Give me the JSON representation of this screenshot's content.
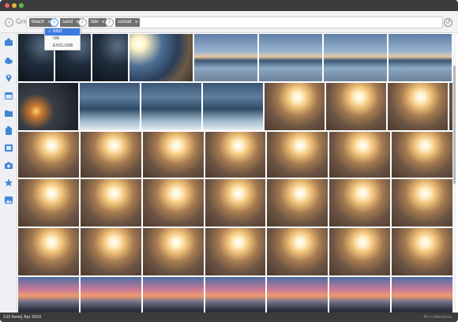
{
  "window": {
    "view_title": "Grid"
  },
  "search": {
    "chips": [
      {
        "label": "beach"
      },
      {
        "label": "sand"
      },
      {
        "label": "tide"
      },
      {
        "label": "sunset"
      }
    ],
    "operators": [
      "+",
      "/",
      "/"
    ]
  },
  "operator_menu": {
    "items": [
      {
        "label": "AND",
        "selected": true
      },
      {
        "label": "OR",
        "selected": false
      },
      {
        "label": "EXCLUDE",
        "selected": false
      }
    ]
  },
  "sidebar": {
    "items": [
      {
        "icon": "import-icon"
      },
      {
        "icon": "cloud-icon"
      },
      {
        "icon": "location-pin-icon"
      },
      {
        "icon": "calendar-icon"
      },
      {
        "icon": "folder-icon"
      },
      {
        "icon": "keyword-tag-icon"
      },
      {
        "icon": "grid-view-icon"
      },
      {
        "icon": "camera-icon"
      },
      {
        "icon": "star-icon"
      },
      {
        "icon": "image-icon"
      }
    ]
  },
  "grid": {
    "rows": [
      [
        "night-beach",
        "night-beach",
        "night-beach",
        "bright-sun-beach",
        "blue-dusk-beach",
        "blue-dusk-beach",
        "blue-dusk-beach",
        "blue-dusk-beach",
        "blue-dusk-beach"
      ],
      [
        "sunset-dark-sea",
        "choppy-water",
        "choppy-water",
        "choppy-water",
        "sunset-sand",
        "sunset-sand",
        "sunset-sand",
        "sunset-sand"
      ],
      [
        "sunset-sand",
        "sunset-sand",
        "sunset-sand",
        "sunset-sand",
        "sunset-sand",
        "sunset-sand",
        "sunset-sand"
      ],
      [
        "sunset-sand",
        "sunset-sand",
        "sunset-sand",
        "sunset-sand",
        "sunset-sand",
        "sunset-sand",
        "sunset-sand"
      ],
      [
        "sunset-sand",
        "sunset-sand",
        "sunset-sand",
        "sunset-sand",
        "sunset-sand",
        "sunset-sand",
        "sunset-sand"
      ],
      [
        "pink-sky-town",
        "pink-sky-town",
        "pink-sky-town",
        "pink-sky-town",
        "pink-sky-town",
        "pink-sky-town",
        "pink-sky-town"
      ]
    ]
  },
  "status": {
    "count": "133 Items",
    "date": "Apr 2016",
    "right": "No Collections"
  },
  "colors": {
    "titlebar": "#3b3b3d",
    "accent": "#3d7be0",
    "sidebar_icon": "#3f86d6"
  }
}
